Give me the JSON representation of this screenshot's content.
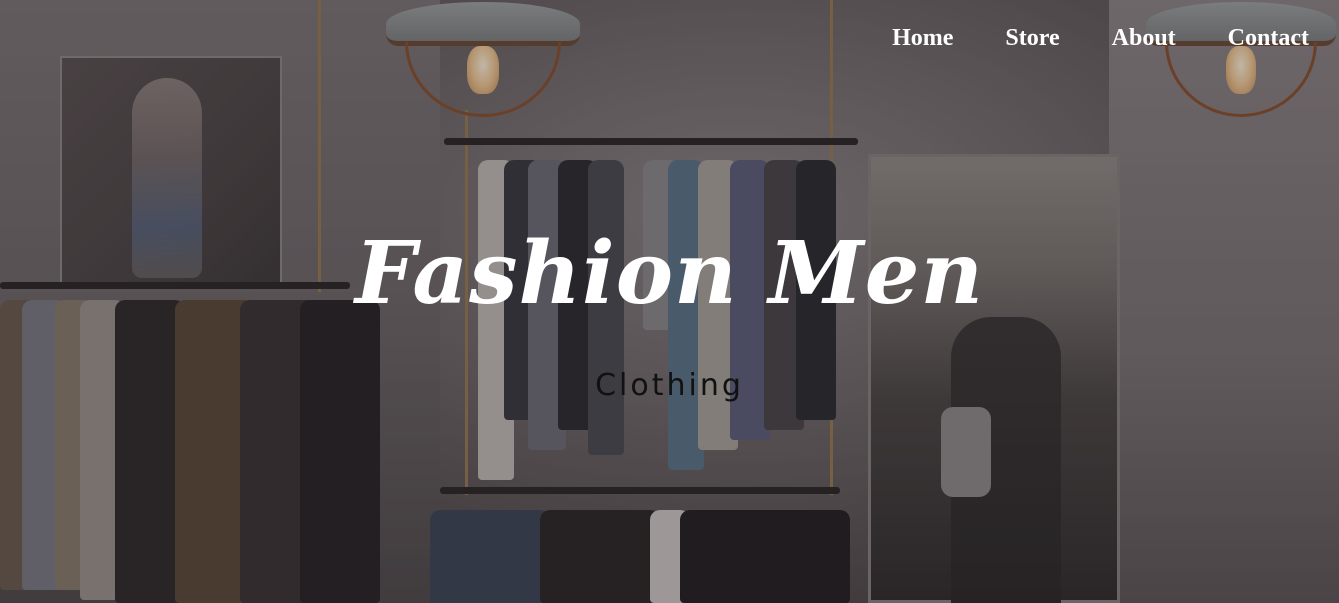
{
  "nav": {
    "items": [
      {
        "label": "Home"
      },
      {
        "label": "Store"
      },
      {
        "label": "About"
      },
      {
        "label": "Contact"
      }
    ]
  },
  "hero": {
    "title": "Fashion Men",
    "subtitle": "Clothing"
  },
  "colors": {
    "nav_text": "#ffffff",
    "title_text": "#ffffff",
    "subtitle_text": "#111111",
    "overlay": "#1e181c"
  }
}
